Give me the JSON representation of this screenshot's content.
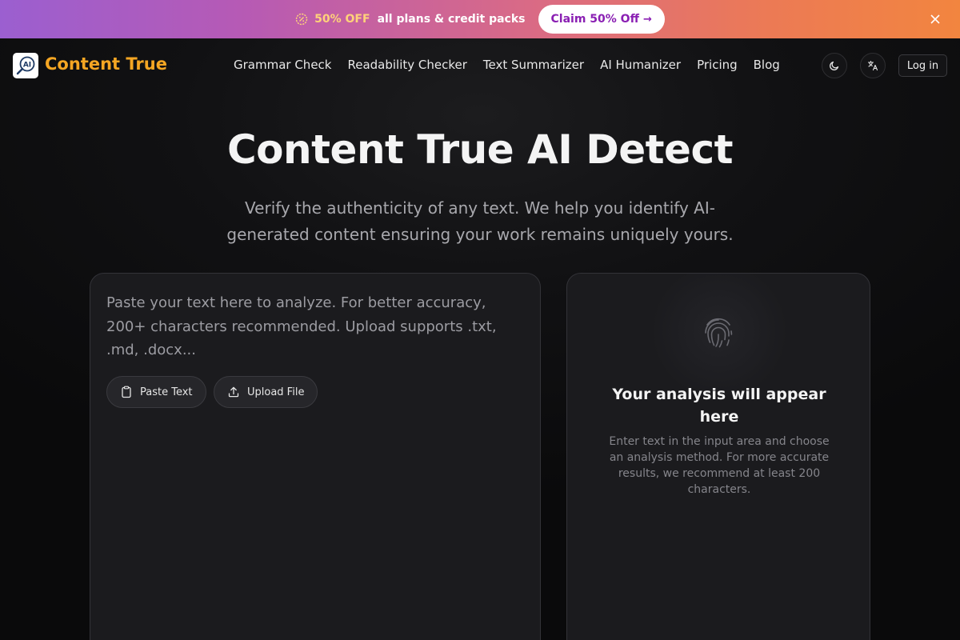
{
  "promo": {
    "discount": "50% OFF",
    "text": "all plans & credit packs",
    "cta_label": "Claim 50% Off",
    "cta_arrow": "→"
  },
  "header": {
    "brand": "Content True",
    "logo_text": "AI",
    "nav": [
      "Grammar Check",
      "Readability Checker",
      "Text Summarizer",
      "AI Humanizer",
      "Pricing",
      "Blog"
    ],
    "login_label": "Log in"
  },
  "hero": {
    "title": "Content True AI Detect",
    "subtitle": "Verify the authenticity of any text. We help you identify AI-generated content ensuring your work remains uniquely yours."
  },
  "input_panel": {
    "placeholder": "Paste your text here to analyze. For better accuracy, 200+ characters recommended. Upload supports .txt, .md, .docx...",
    "paste_label": "Paste Text",
    "upload_label": "Upload File"
  },
  "result_panel": {
    "title": "Your analysis will appear here",
    "description": "Enter text in the input area and choose an analysis method. For more accurate results, we recommend at least 200 characters."
  },
  "colors": {
    "brand": "#f5a623",
    "promo_gradient_start": "#9b5fd0",
    "promo_gradient_end": "#f2853f",
    "cta_text": "#8a1fb3"
  },
  "icons": {
    "promo": "badge-percent-icon",
    "close": "close-icon",
    "theme": "moon-icon",
    "language": "translate-icon",
    "paste": "clipboard-icon",
    "upload": "upload-icon",
    "result": "fingerprint-icon"
  }
}
